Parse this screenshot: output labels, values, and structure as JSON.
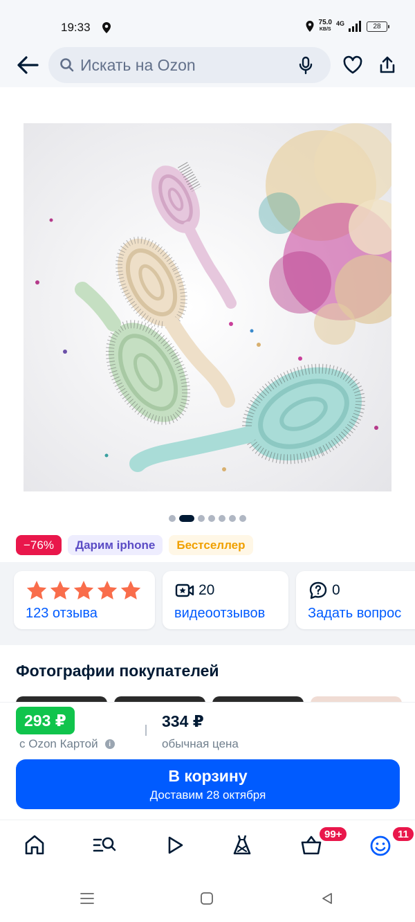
{
  "status_bar": {
    "time": "19:33",
    "net_speed": "75.0",
    "net_unit": "KB/S",
    "network": "4G",
    "battery": "28"
  },
  "header": {
    "search_placeholder": "Искать на Ozon",
    "icons": [
      "arrow-left-icon",
      "search-icon",
      "mic-icon",
      "heart-icon",
      "share-icon"
    ]
  },
  "gallery": {
    "image_description": "hair brushes",
    "dots_total": 7,
    "active_dot": 1
  },
  "badges": {
    "discount": "−76%",
    "gift": "Дарим iphone",
    "bestseller": "Бестселлер"
  },
  "cards": {
    "rating_stars": 5,
    "reviews": "123 отзыва",
    "video_count": "20",
    "video_label": "видеоотзывов",
    "questions_count": "0",
    "questions_label": "Задать вопрос"
  },
  "section": {
    "customer_photos_title": "Фотографии покупателей"
  },
  "price": {
    "ozon_card_price": "293 ₽",
    "ozon_card_label": "с Ozon Картой",
    "regular_price": "334 ₽",
    "regular_label": "обычная цена"
  },
  "cart_button": {
    "label": "В корзину",
    "delivery": "Доставим 28 октября"
  },
  "bottom_nav": {
    "items": [
      "home-icon",
      "catalog-icon",
      "video-icon",
      "fashion-icon",
      "cart-icon",
      "profile-icon"
    ],
    "cart_badge": "99+",
    "profile_badge": "11"
  },
  "colors": {
    "primary": "#005bff",
    "green_price": "#10c44c",
    "discount": "#e9174b",
    "star": "#f96d4b"
  }
}
